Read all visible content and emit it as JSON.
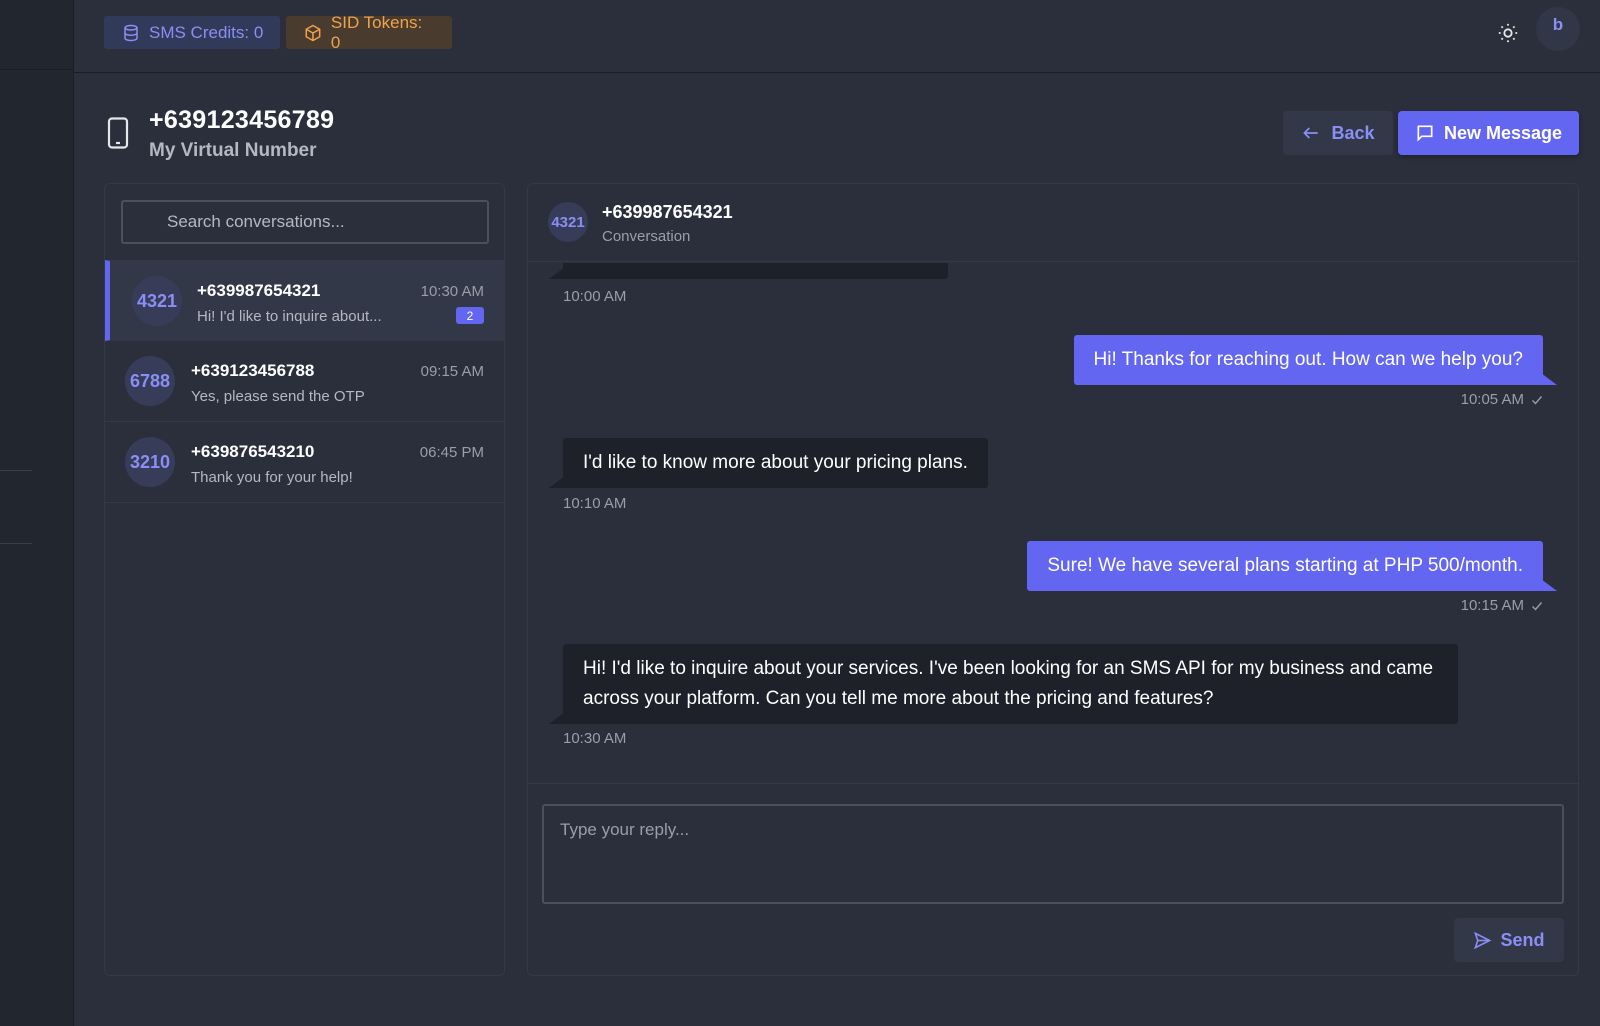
{
  "topbar": {
    "sms_credits": "SMS Credits: 0",
    "sid_tokens": "SID Tokens: 0",
    "avatar_initial": "b"
  },
  "header": {
    "title": "+639123456789",
    "subtitle": "My Virtual Number",
    "back_label": "Back",
    "new_message_label": "New Message"
  },
  "search": {
    "placeholder": "Search conversations..."
  },
  "conversations": [
    {
      "avatar": "4321",
      "name": "+639987654321",
      "preview": "Hi! I'd like to inquire about...",
      "time": "10:30 AM",
      "unread": "2",
      "active": true
    },
    {
      "avatar": "6788",
      "name": "+639123456788",
      "preview": "Yes, please send the OTP",
      "time": "09:15 AM"
    },
    {
      "avatar": "3210",
      "name": "+639876543210",
      "preview": "Thank you for your help!",
      "time": "06:45 PM"
    }
  ],
  "chat": {
    "avatar": "4321",
    "name": "+639987654321",
    "label": "Conversation",
    "messages": [
      {
        "direction": "in",
        "text": "",
        "time": "10:00 AM"
      },
      {
        "direction": "out",
        "text": "Hi! Thanks for reaching out. How can we help you?",
        "time": "10:05 AM"
      },
      {
        "direction": "in",
        "text": "I'd like to know more about your pricing plans.",
        "time": "10:10 AM"
      },
      {
        "direction": "out",
        "text": "Sure! We have several plans starting at PHP 500/month.",
        "time": "10:15 AM"
      },
      {
        "direction": "in",
        "text": "Hi! I'd like to inquire about your services. I've been looking for an SMS API for my business and came across your platform. Can you tell me more about the pricing and features?",
        "time": "10:30 AM"
      }
    ]
  },
  "reply": {
    "placeholder": "Type your reply...",
    "send_label": "Send"
  },
  "colors": {
    "accent": "#6366f1",
    "sms_pill": "#8a8ef5",
    "sid_pill": "#f0a24a",
    "background": "#2a2f3b"
  }
}
